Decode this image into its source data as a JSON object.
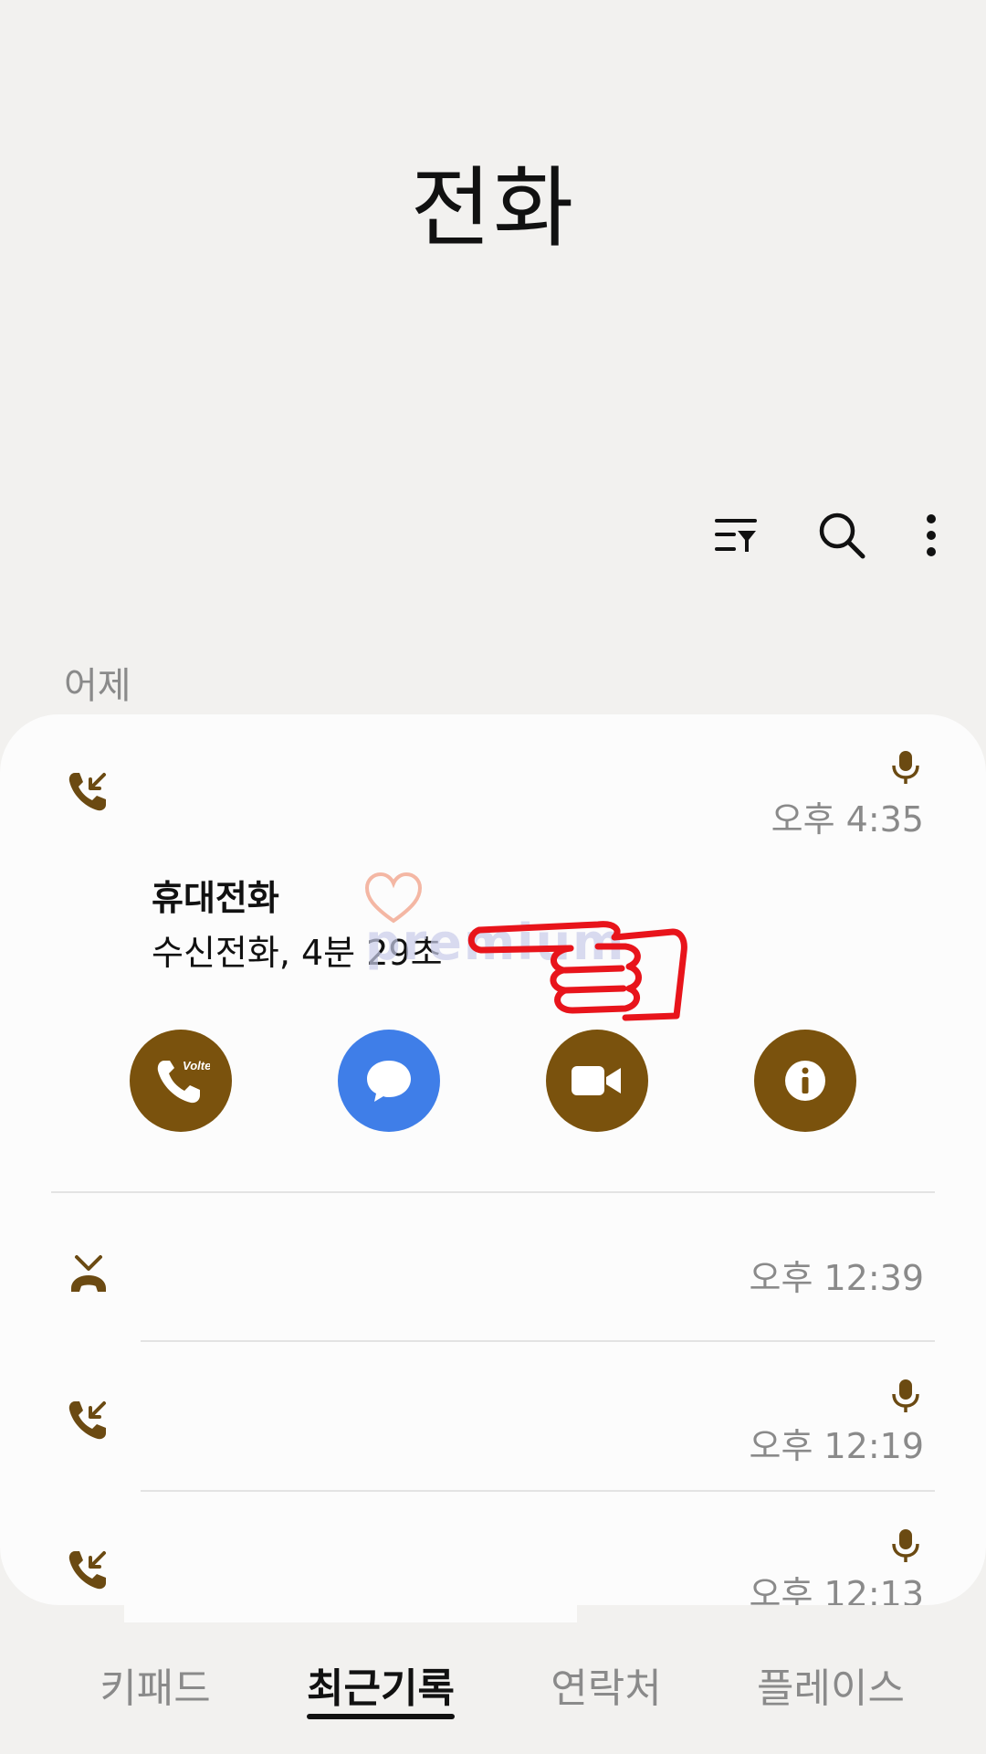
{
  "header": {
    "title": "전화"
  },
  "toolbar": {
    "icons": [
      "filter-icon",
      "search-icon",
      "more-options-icon"
    ]
  },
  "section": {
    "label": "어제"
  },
  "expanded_call": {
    "name": "휴대전화",
    "detail": "수신전화, 4분 29초",
    "time": "오후 4:35",
    "type_icon": "incoming-call-icon",
    "has_recording": true,
    "actions": [
      {
        "name": "voice-call-volte",
        "icon": "phone-volte-icon",
        "color": "#7a520d",
        "badge": "Volte"
      },
      {
        "name": "message",
        "icon": "message-bubble-icon",
        "color": "#3f7ee8"
      },
      {
        "name": "video-call",
        "icon": "video-camera-icon",
        "color": "#7a520d"
      },
      {
        "name": "details",
        "icon": "info-icon",
        "color": "#7a520d"
      }
    ]
  },
  "calls": [
    {
      "time": "오후 12:39",
      "type_icon": "missed-call-icon",
      "has_recording": false
    },
    {
      "time": "오후 12:19",
      "type_icon": "incoming-call-icon",
      "has_recording": true
    },
    {
      "time": "오후 12:13",
      "type_icon": "incoming-call-icon",
      "has_recording": true
    }
  ],
  "bottom_tabs": [
    {
      "label": "키패드",
      "active": false
    },
    {
      "label": "최근기록",
      "active": true
    },
    {
      "label": "연락처",
      "active": false
    },
    {
      "label": "플레이스",
      "active": false
    }
  ],
  "overlay": {
    "watermark": "premium"
  },
  "colors": {
    "accent": "#7a520d",
    "message": "#3f7ee8",
    "background": "#f2f1ef",
    "card": "#fcfcfc",
    "annotation": "#e8141b"
  }
}
